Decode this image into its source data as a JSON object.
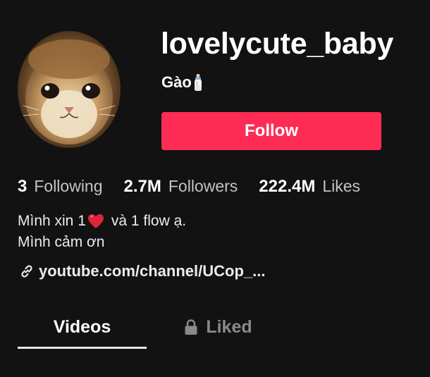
{
  "profile": {
    "username": "lovelycute_baby",
    "nickname": "Gào",
    "nickname_icon": "baby-bottle-icon",
    "avatar_icon": "cat-avatar"
  },
  "actions": {
    "follow_label": "Follow",
    "follow_color": "#fe2c55"
  },
  "stats": {
    "following": {
      "count": "3",
      "label": "Following"
    },
    "followers": {
      "count": "2.7M",
      "label": "Followers"
    },
    "likes": {
      "count": "222.4M",
      "label": "Likes"
    }
  },
  "bio": {
    "line1_before": "Mình xin 1",
    "line1_icon": "red-heart-icon",
    "line1_after": "và 1 flow ạ.",
    "line2": "Mình cảm ơn"
  },
  "link": {
    "icon": "link-icon",
    "text": "youtube.com/channel/UCop_..."
  },
  "tabs": {
    "videos": "Videos",
    "liked": "Liked",
    "liked_icon": "lock-icon",
    "active": "videos"
  },
  "theme": {
    "background": "#121212",
    "text": "#ffffff",
    "muted": "#8a8a8a"
  }
}
